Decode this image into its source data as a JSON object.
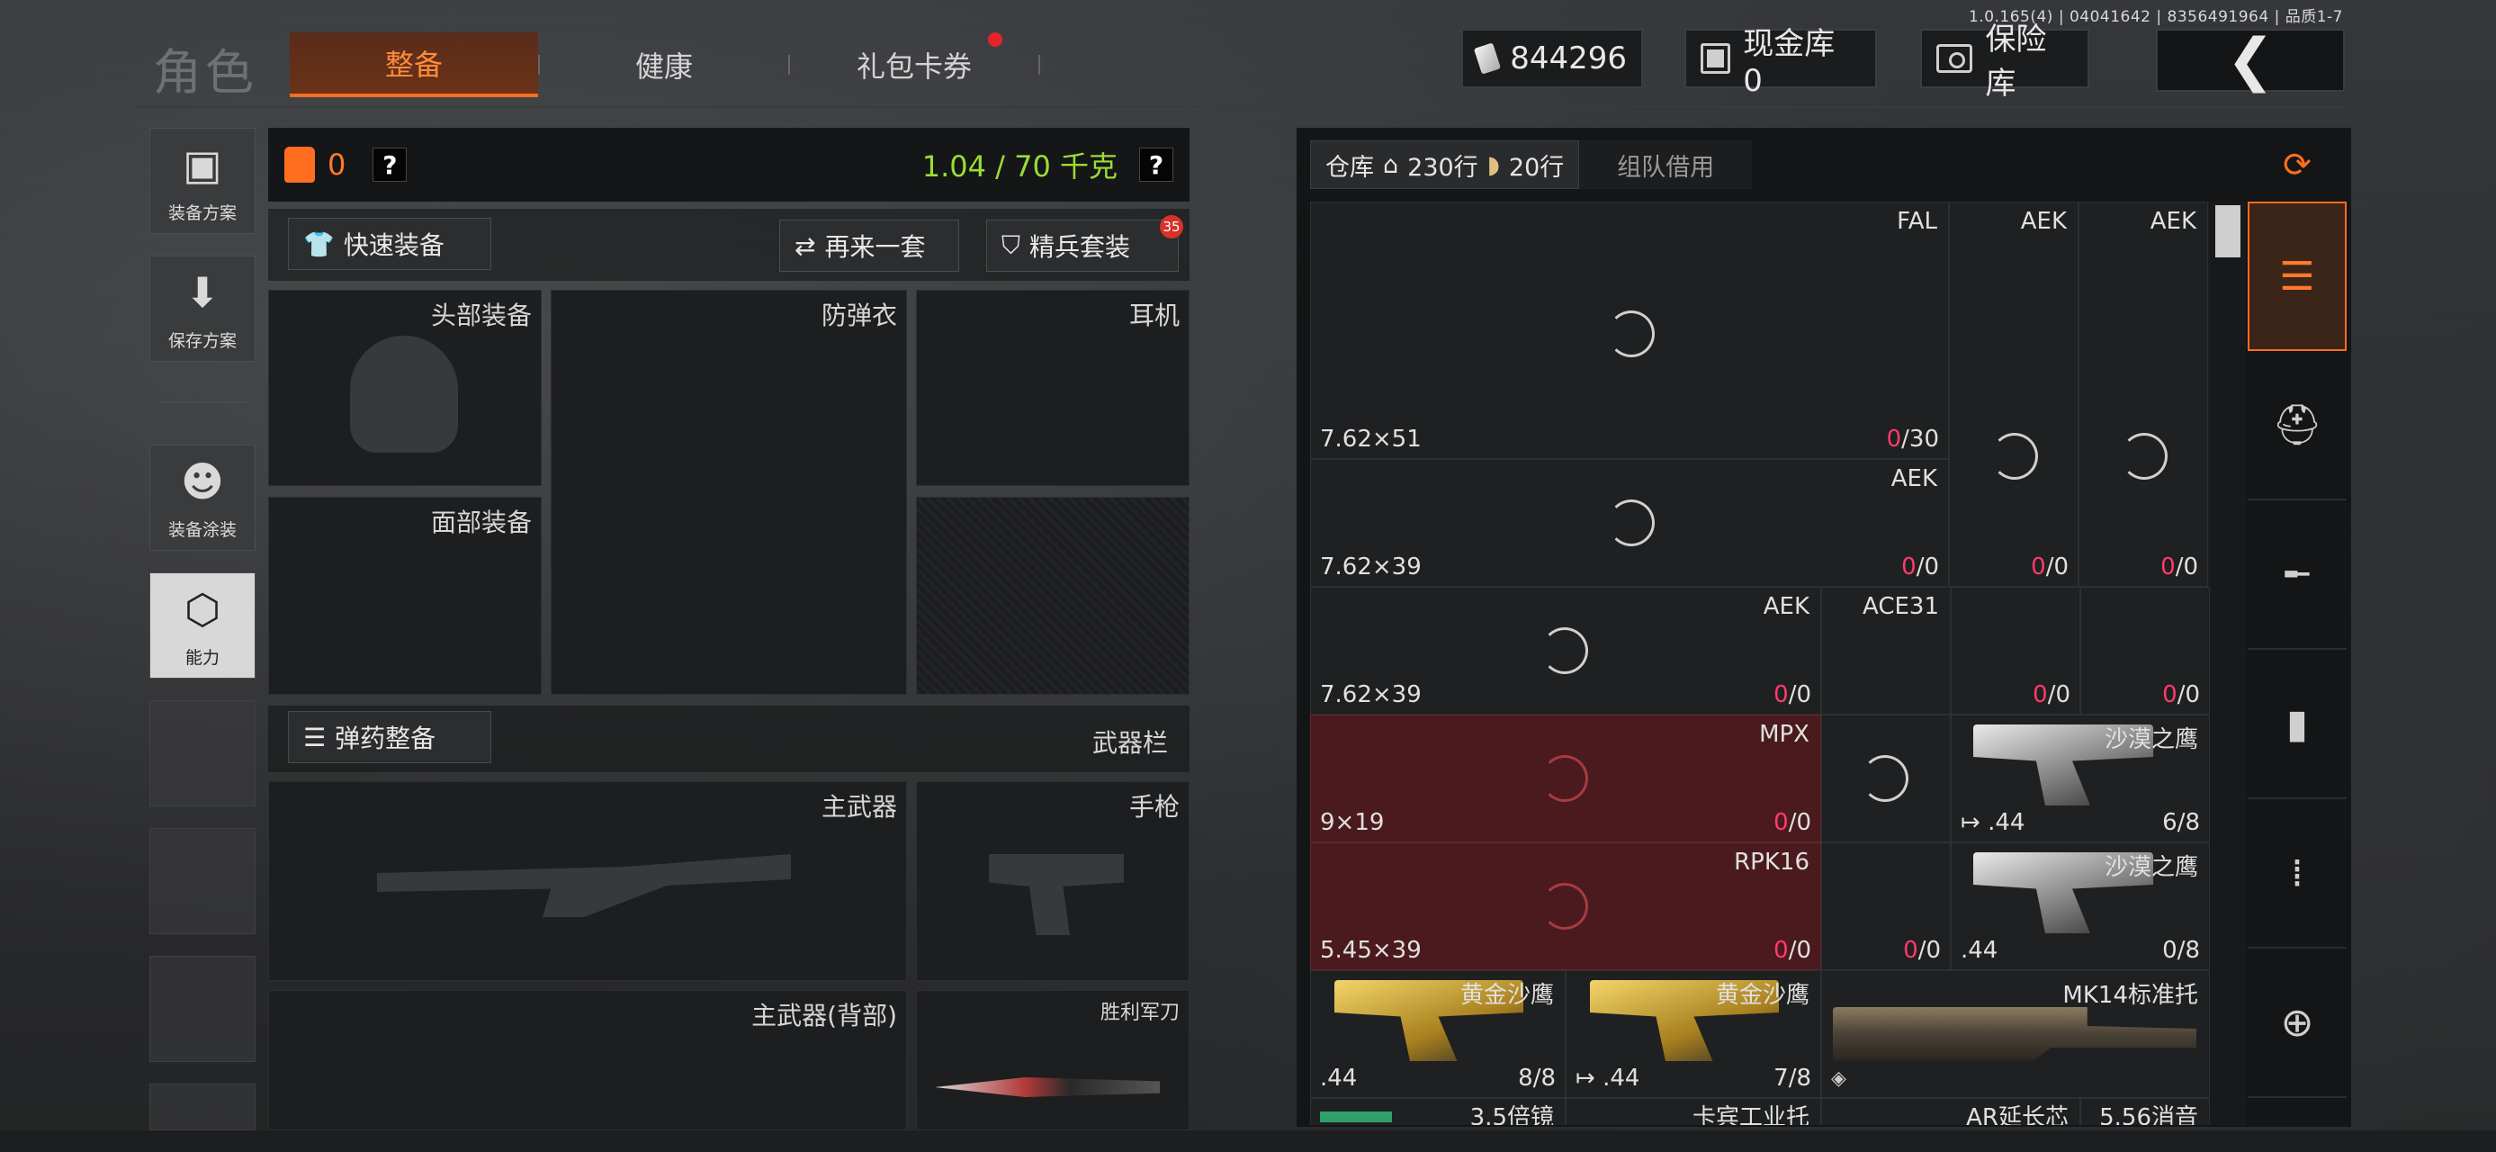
{
  "version": "1.0.165(4) | 04041642 | 8356491964 | 品质1-7",
  "header": {
    "title": "角色",
    "tabs": [
      {
        "label": "整备",
        "active": true
      },
      {
        "label": "健康",
        "active": false
      },
      {
        "label": "礼包卡券",
        "active": false,
        "notification": true
      }
    ],
    "cash": "844296",
    "cash_icon": "cash-stack-icon",
    "cash_vault_label": "现金库 0",
    "safe_label": "保险库",
    "back_icon": "chevron-left-icon"
  },
  "sidebar": {
    "items": [
      {
        "label": "装备方案",
        "icon": "vest-icon"
      },
      {
        "label": "保存方案",
        "icon": "download-icon"
      },
      {
        "label": "装备涂装",
        "icon": "helmet-soldier-icon"
      },
      {
        "label": "能力",
        "icon": "lightning-hex-icon",
        "active": true
      }
    ]
  },
  "loadout": {
    "armor_count": "0",
    "weight": "1.04 / 70 千克",
    "help": "?",
    "quick_equip": "快速装备",
    "again": "再来一套",
    "elite": "精兵套装",
    "elite_badge": "35",
    "slots": {
      "head": "头部装备",
      "vest": "防弹衣",
      "ear": "耳机",
      "face": "面部装备",
      "ammo_btn": "弹药整备",
      "weapon_bar": "武器栏",
      "primary": "主武器",
      "pistol": "手枪",
      "primary_back": "主武器(背部)",
      "knife": "胜利军刀"
    }
  },
  "inventory": {
    "warehouse_label": "仓库",
    "rows_home": "230行",
    "rows_ammo": "20行",
    "team_borrow": "组队借用",
    "cells": [
      {
        "name": "FAL",
        "caliber": "7.62×51",
        "count_zero": "0",
        "count_rest": "/30"
      },
      {
        "name": "AEK",
        "caliber": "",
        "count_zero": "",
        "count_rest": ""
      },
      {
        "name": "AEK",
        "caliber": "",
        "count_zero": "",
        "count_rest": ""
      },
      {
        "name": "AEK",
        "caliber": "7.62×39",
        "count_zero": "0",
        "count_rest": "/0"
      },
      {
        "name": "AEK",
        "caliber": "7.62×39",
        "count_zero": "0",
        "count_rest": "/0"
      },
      {
        "name": "ACE31",
        "caliber": "",
        "count_zero": "",
        "count_rest": ""
      },
      {
        "name": "",
        "caliber": "",
        "count_zero": "0",
        "count_rest": "/0"
      },
      {
        "name": "",
        "caliber": "",
        "count_zero": "0",
        "count_rest": "/0"
      },
      {
        "name": "MPX",
        "caliber": "9×19",
        "count_zero": "0",
        "count_rest": "/0"
      },
      {
        "name": "沙漠之鹰",
        "caliber": ".44",
        "count_zero": "",
        "count_rest": "6/8"
      },
      {
        "name": "RPK16",
        "caliber": "5.45×39",
        "count_zero": "0",
        "count_rest": "/0"
      },
      {
        "name": "",
        "caliber": "",
        "count_zero": "0",
        "count_rest": "/0"
      },
      {
        "name": "沙漠之鹰",
        "caliber": ".44",
        "count_zero": "",
        "count_rest": "0/8"
      },
      {
        "name": "黄金沙鹰",
        "caliber": ".44",
        "count_zero": "",
        "count_rest": "8/8"
      },
      {
        "name": "黄金沙鹰",
        "caliber": ".44",
        "count_zero": "",
        "count_rest": "7/8"
      },
      {
        "name": "MK14标准托",
        "caliber": "",
        "count_zero": "",
        "count_rest": ""
      },
      {
        "name": "3.5倍镜",
        "caliber": "",
        "count_zero": "",
        "count_rest": ""
      },
      {
        "name": "卡宾工业托",
        "caliber": "",
        "count_zero": "",
        "count_rest": ""
      },
      {
        "name": "AR延长芯",
        "caliber": "",
        "count_zero": "",
        "count_rest": ""
      },
      {
        "name": "5.56消音",
        "caliber": "",
        "count_zero": "",
        "count_rest": ""
      }
    ],
    "categories": [
      "stack-refresh-icon",
      "layers-all-icon",
      "helmet-icon",
      "rifle-icon",
      "magazine-icon",
      "ammo-icon",
      "scope-icon"
    ]
  },
  "colors": {
    "accent": "#ff6d1f",
    "weight_green": "#9bdc34",
    "zero_pink": "#ff3a6e",
    "red_cell": "#4a1a1e"
  }
}
